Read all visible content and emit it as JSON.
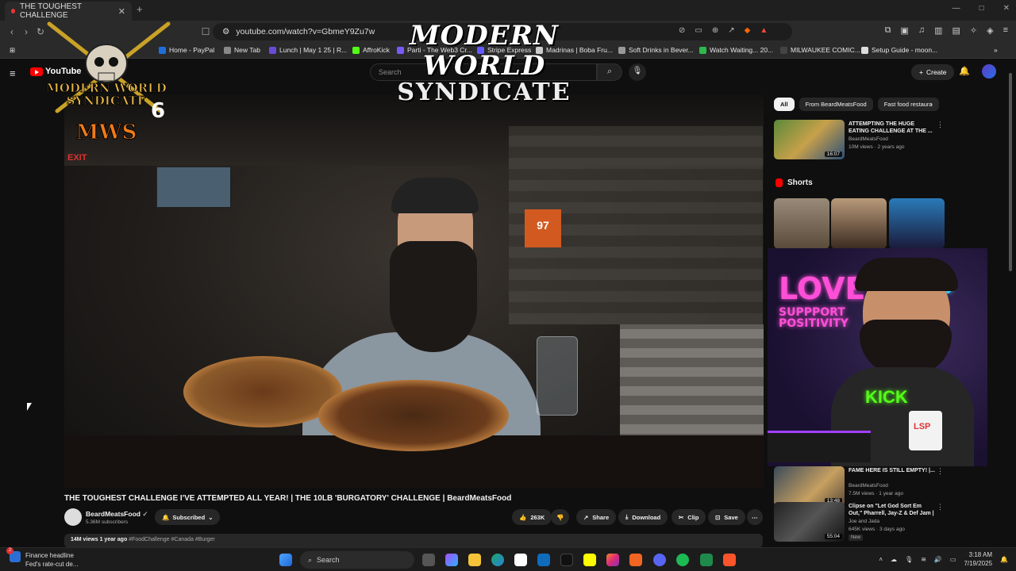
{
  "browser": {
    "tab_title": "THE TOUGHEST CHALLENGE",
    "url": "youtube.com/watch?v=GbmeY9Zu7w",
    "bookmarks": [
      {
        "label": "Home - PayPal",
        "color": "#1f6fdb"
      },
      {
        "label": "New Tab",
        "color": "#888888"
      },
      {
        "label": "Lunch | May 1 25 | R...",
        "color": "#6a4ad9"
      },
      {
        "label": "AffroKick",
        "color": "#53fc18"
      },
      {
        "label": "Parti - The Web3 Cr...",
        "color": "#7a5af8"
      },
      {
        "label": "Stripe Express",
        "color": "#635bff"
      },
      {
        "label": "Madrinas | Boba Fru...",
        "color": "#cccccc"
      },
      {
        "label": "Soft Drinks in Bever...",
        "color": "#999999"
      },
      {
        "label": "Watch Waiting... 20...",
        "color": "#2fb84c"
      },
      {
        "label": "MILWAUKEE COMIC...",
        "color": "#444444"
      },
      {
        "label": "Setup Guide - moon...",
        "color": "#dddddd"
      }
    ]
  },
  "youtube": {
    "logo_text": "YouTube",
    "search_placeholder": "Search",
    "create_label": "Create"
  },
  "overlay": {
    "title_line1": "MODERN WORLD",
    "title_line2": "SYNDICATE",
    "logo_line1": "MODERN WORLD",
    "logo_line2": "SYNDICATE",
    "logo_number": "6",
    "logo_short": "MWS",
    "promo_line1": "LOVE",
    "promo_line2": "SUPPPORT",
    "promo_line3": "POSITIVITY",
    "promo_kick": "KICK",
    "promo_badge": "LSP"
  },
  "video": {
    "title": "THE TOUGHEST CHALLENGE I'VE ATTEMPTED ALL YEAR! | THE 10LB 'BURGATORY' CHALLENGE | BeardMeatsFood",
    "channel": "BeardMeatsFood",
    "subscribers": "5.36M subscribers",
    "subscribed_label": "Subscribed",
    "likes": "263K",
    "share_label": "Share",
    "download_label": "Download",
    "clip_label": "Clip",
    "save_label": "Save",
    "views": "14M views",
    "age": "1 year ago",
    "tags": "#FoodChallenge #Canada #Burger",
    "scene_sign": "EXIT",
    "jersey_number": "97"
  },
  "sidebar": {
    "chips": [
      "All",
      "From BeardMeatsFood",
      "Fast food restaura"
    ],
    "shorts_label": "Shorts",
    "recs": [
      {
        "title": "ATTEMPTING THE HUGE EATING CHALLENGE AT THE ...",
        "channel": "BeardMeatsFood",
        "meta": "10M views · 2 years ago",
        "duration": "16:07",
        "badge": ""
      },
      {
        "title": "FAME HERE IS STILL EMPTY! |...",
        "channel": "BeardMeatsFood",
        "meta": "7.5M views · 1 year ago",
        "duration": "13:48",
        "badge": ""
      },
      {
        "title": "Clipse on \"Let God Sort Em Out,\" Pharrell, Jay-Z & Def Jam | Fat...",
        "channel": "Joe and Jada",
        "meta": "645K views · 3 days ago",
        "duration": "55:04",
        "badge": "New"
      }
    ]
  },
  "taskbar": {
    "news_title": "Finance headline",
    "news_sub": "Fed's rate-cut de...",
    "notif_count": "2",
    "search_label": "Search",
    "time": "3:18 AM",
    "date": "7/19/2025"
  },
  "colors": {
    "youtube_red": "#ff0000",
    "kick_green": "#53fc18",
    "promo_pink": "#ff4fd8"
  }
}
